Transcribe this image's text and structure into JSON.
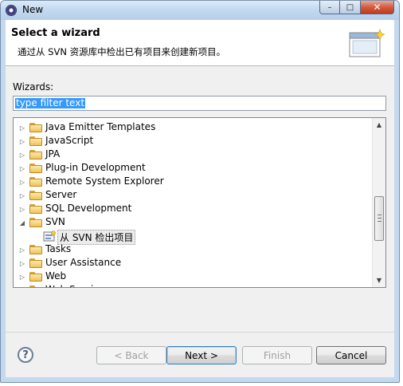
{
  "window": {
    "title": "New",
    "controls": {
      "minimize": "–",
      "maximize": "□",
      "close": "✕"
    }
  },
  "banner": {
    "title": "Select a wizard",
    "description": "通过从 SVN 资源库中检出已有项目来创建新项目。"
  },
  "filter": {
    "label": "Wizards:",
    "value": "type filter text"
  },
  "tree": {
    "items": [
      {
        "label": "Java Emitter Templates",
        "expanded": false
      },
      {
        "label": "JavaScript",
        "expanded": false
      },
      {
        "label": "JPA",
        "expanded": false
      },
      {
        "label": "Plug-in Development",
        "expanded": false
      },
      {
        "label": "Remote System Explorer",
        "expanded": false
      },
      {
        "label": "Server",
        "expanded": false
      },
      {
        "label": "SQL Development",
        "expanded": false
      },
      {
        "label": "SVN",
        "expanded": true
      },
      {
        "label": "从 SVN 检出项目",
        "child": true,
        "selected": true
      },
      {
        "label": "Tasks",
        "expanded": false
      },
      {
        "label": "User Assistance",
        "expanded": false
      },
      {
        "label": "Web",
        "expanded": false
      },
      {
        "label": "Web Services",
        "expanded": false
      }
    ]
  },
  "buttons": {
    "help": "?",
    "back": "< Back",
    "next": "Next >",
    "finish": "Finish",
    "cancel": "Cancel"
  },
  "icons": {
    "twisty_collapsed": "▷",
    "twisty_expanded": "◢",
    "scroll_up": "▲",
    "scroll_down": "▼"
  }
}
